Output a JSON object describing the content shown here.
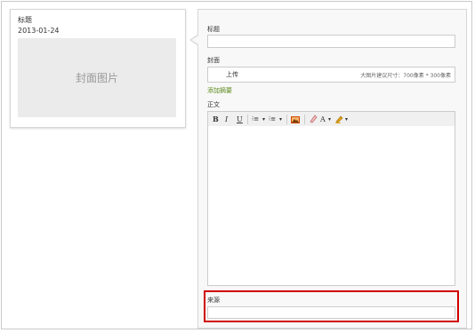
{
  "preview": {
    "title": "标题",
    "date": "2013-01-24",
    "cover_placeholder": "封面图片"
  },
  "form": {
    "title_label": "标题",
    "title_value": "",
    "cover_label": "封面",
    "upload_label": "上传",
    "cover_hint": "大图片建议尺寸：700像素 * 300像素",
    "add_summary_label": "添加摘要",
    "body_label": "正文",
    "source_label": "来源",
    "source_value": ""
  },
  "toolbar": {
    "bold": "B",
    "italic": "I",
    "underline": "U",
    "ordered_list": "⁝≡",
    "unordered_list": "⁝≡",
    "dropdown": "▾",
    "font_color": "A",
    "icons": [
      "bold-icon",
      "italic-icon",
      "underline-icon",
      "ordered-list-icon",
      "unordered-list-icon",
      "image-icon",
      "eraser-icon",
      "font-color-icon",
      "highlight-icon"
    ]
  },
  "colors": {
    "highlight_border": "#d00000",
    "link_green": "#5a8a1a"
  }
}
